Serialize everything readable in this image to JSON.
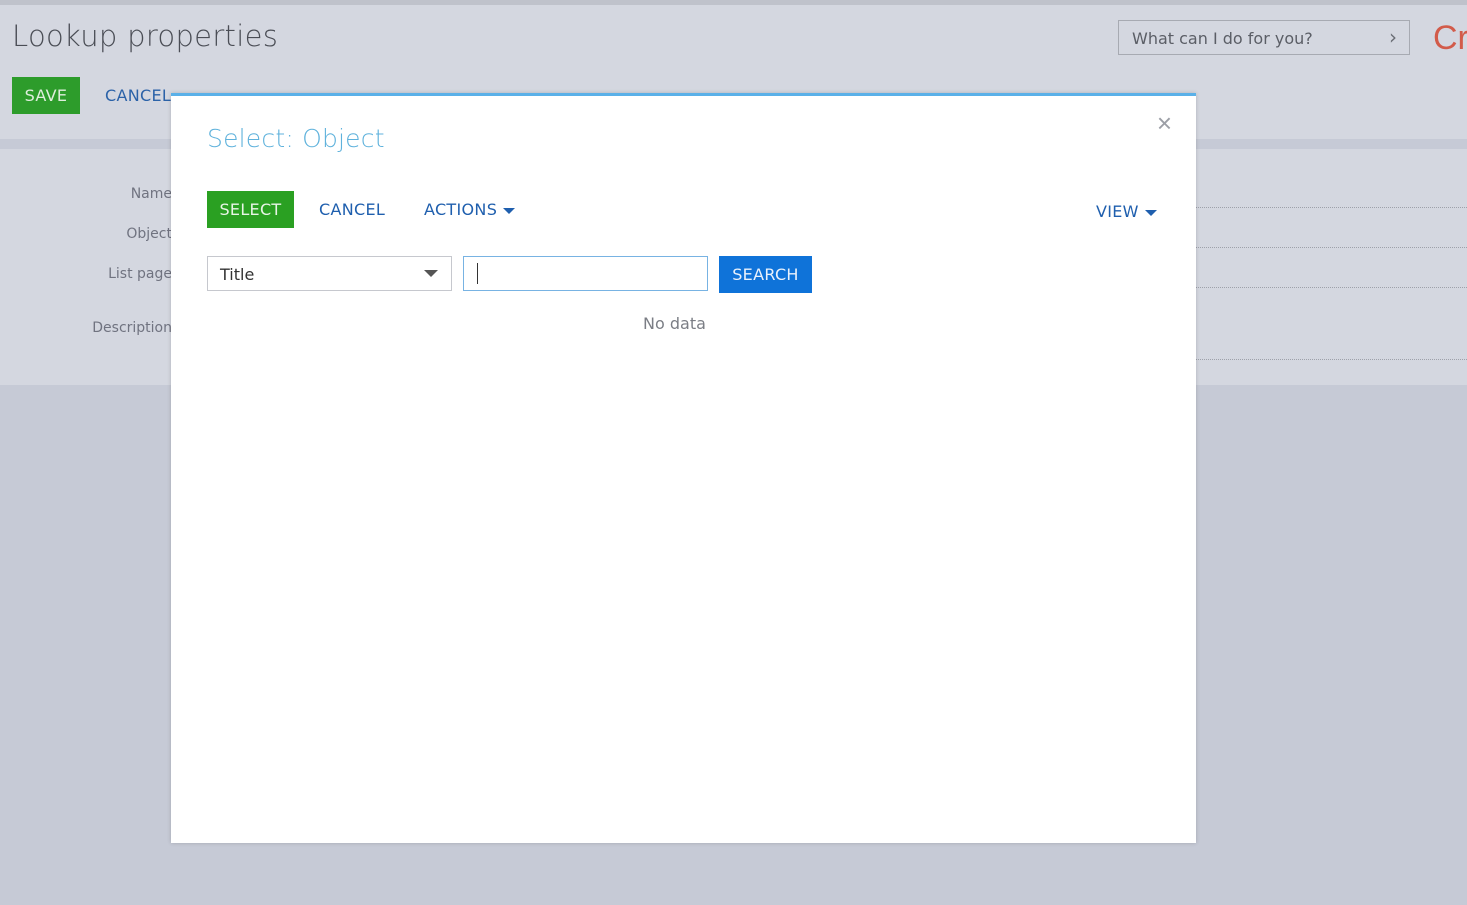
{
  "page": {
    "title": "Lookup properties",
    "save_label": "SAVE",
    "cancel_label": "CANCEL",
    "command_placeholder": "What can I do for you?",
    "brand_text": "Cr",
    "form_labels": [
      "Name",
      "Object",
      "List page",
      "Description"
    ]
  },
  "modal": {
    "title": "Select: Object",
    "select_label": "SELECT",
    "cancel_label": "CANCEL",
    "actions_label": "ACTIONS",
    "view_label": "VIEW",
    "filter_field": "Title",
    "search_value": "",
    "search_label": "SEARCH",
    "empty_text": "No data"
  },
  "colors": {
    "accent_green": "#2aa022",
    "accent_blue": "#0f73d9",
    "link_blue": "#1f5fae",
    "modal_top_border": "#5ab0e8",
    "brand_red": "#d25b4a"
  },
  "icons": {
    "close": "close-icon",
    "command_arrow": "chevron-right-icon",
    "dropdown": "caret-down-icon"
  }
}
